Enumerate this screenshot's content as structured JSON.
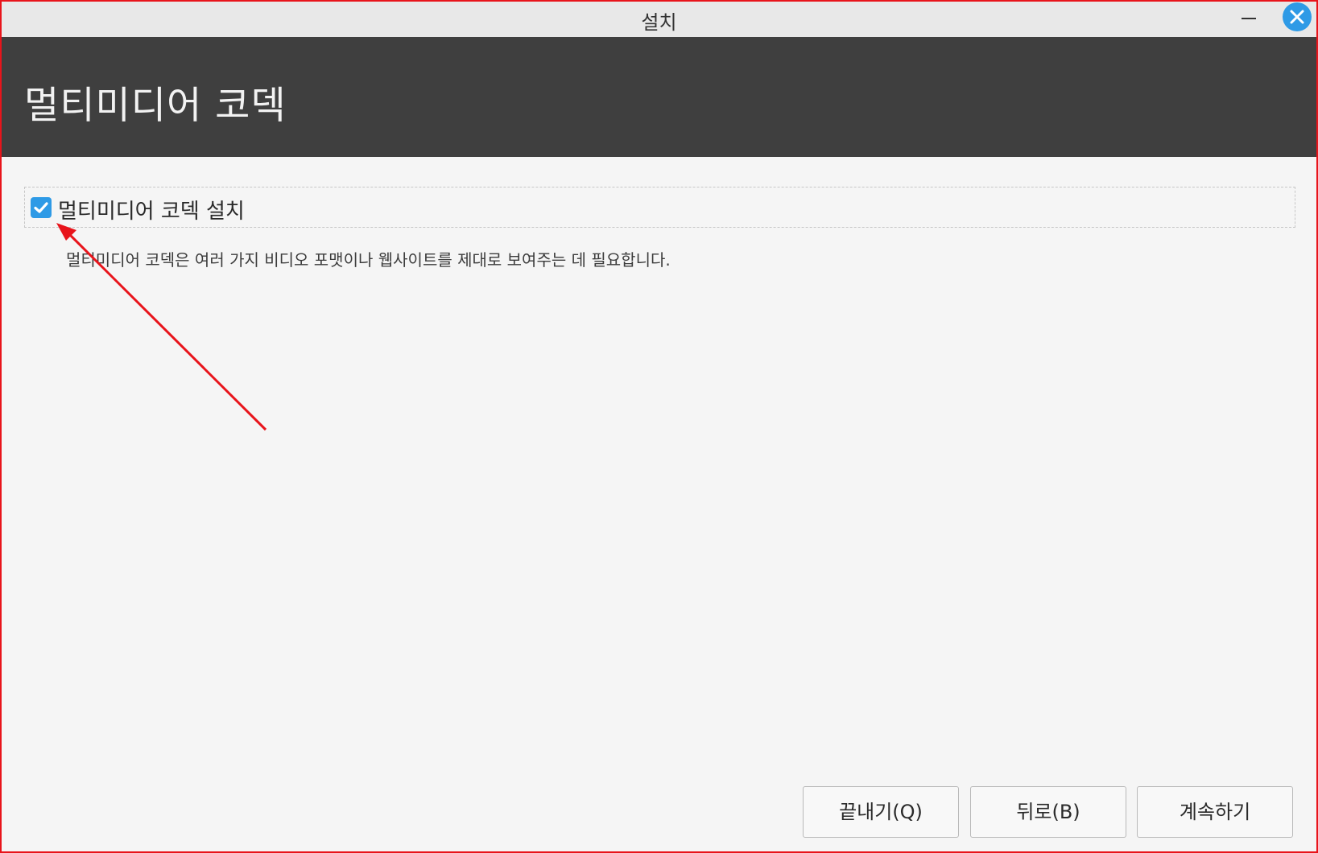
{
  "window": {
    "title": "설치"
  },
  "header": {
    "title": "멀티미디어 코덱"
  },
  "option": {
    "label": "멀티미디어 코덱 설치",
    "checked": true,
    "description": "멀티미디어 코덱은 여러 가지 비디오 포맷이나 웹사이트를 제대로 보여주는 데 필요합니다."
  },
  "buttons": {
    "quit_label": "끝내기(Q)",
    "back_label": "뒤로(B)",
    "continue_label": "계속하기"
  },
  "icons": {
    "minimize": "minimize-icon",
    "close": "close-icon",
    "checkbox": "checkmark-icon"
  },
  "colors": {
    "accent": "#2e9ae6",
    "header_background": "#3f3f3f",
    "annotation": "#e8141b"
  }
}
